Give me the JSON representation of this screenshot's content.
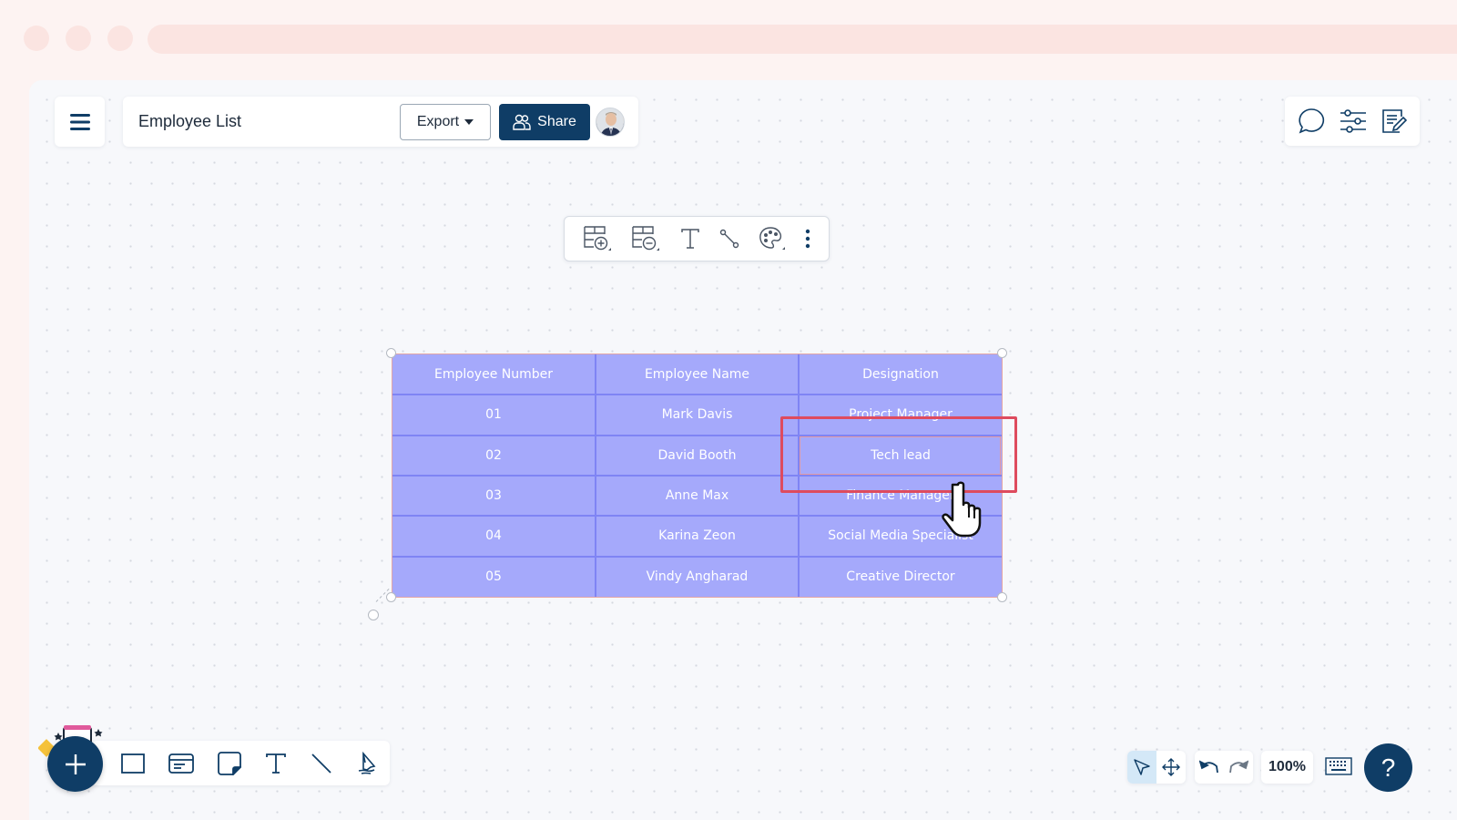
{
  "header": {
    "title": "Employee List",
    "export_label": "Export",
    "share_label": "Share",
    "menu_icon": "hamburger-menu-icon",
    "avatar": "user-avatar"
  },
  "right_panel": {
    "icons": [
      "comment-icon",
      "settings-sliders-icon",
      "notes-edit-icon"
    ]
  },
  "context_toolbar": {
    "icons": [
      "add-table-row-icon",
      "remove-table-row-icon",
      "text-icon",
      "connector-icon",
      "color-palette-icon",
      "more-options-icon"
    ]
  },
  "table": {
    "headers": [
      "Employee Number",
      "Employee Name",
      "Designation"
    ],
    "rows": [
      [
        "01",
        "Mark Davis",
        "Project Manager"
      ],
      [
        "02",
        "David Booth",
        "Tech lead"
      ],
      [
        "03",
        "Anne Max",
        "Finance Manager"
      ],
      [
        "04",
        "Karina Zeon",
        "Social Media Specialist"
      ],
      [
        "05",
        "Vindy Angharad",
        "Creative Director"
      ]
    ],
    "selected_cell": "Tech lead",
    "fill_color": "#a5a9fb",
    "border_color": "#7f84f4"
  },
  "highlight_color": "#de4b5e",
  "bottom_toolbar": {
    "add_icon": "plus-icon",
    "tools": [
      "rectangle-icon",
      "card-icon",
      "sticky-note-icon",
      "text-icon",
      "line-icon",
      "pen-icon"
    ]
  },
  "navigation": {
    "select_icon": "pointer-icon",
    "pan_icon": "pan-move-icon",
    "undo_icon": "undo-icon",
    "redo_icon": "redo-icon",
    "zoom_level": "100%",
    "keyboard_icon": "keyboard-icon",
    "help_label": "?"
  },
  "brand_color": "#0f3d66"
}
